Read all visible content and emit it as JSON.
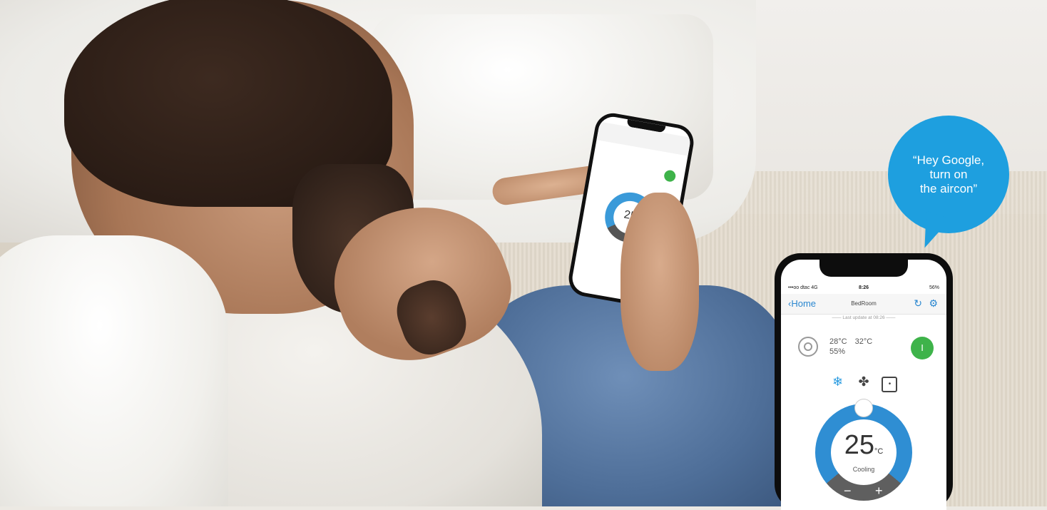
{
  "bubble": {
    "line1": "“Hey Google,",
    "line2": "turn on",
    "line3": "the aircon”"
  },
  "phone": {
    "status": {
      "carrier": "•••oo dtac  4G",
      "time": "8:26",
      "battery": "56%"
    },
    "nav": {
      "back_label": "Home",
      "title": "BedRoom"
    },
    "last_update": "—— Last update at 08:26 ——",
    "readings": {
      "indoor": "28°C",
      "outdoor": "32°C",
      "humidity": "55%"
    },
    "power_label": "I",
    "dial": {
      "temperature": "25",
      "unit": "°C",
      "mode": "Cooling",
      "minus": "−",
      "plus": "+"
    }
  },
  "small_phone": {
    "temperature": "25"
  },
  "colors": {
    "accent": "#1e9fdf",
    "power_on": "#3eb34a",
    "dial_blue": "#2f8ed3"
  },
  "icons": [
    "home-back-icon",
    "refresh-icon",
    "settings-icon",
    "power-ring-icon",
    "snowflake-icon",
    "fan-icon",
    "dry-icon"
  ]
}
